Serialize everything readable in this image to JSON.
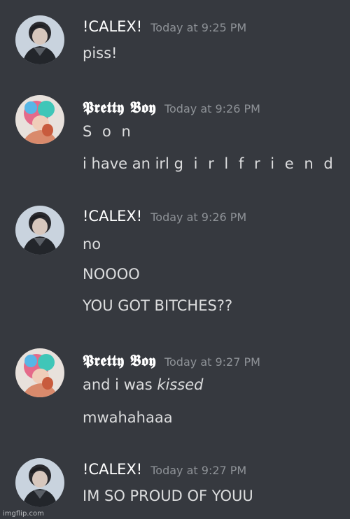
{
  "messages": [
    {
      "username": "!CALEX!",
      "timestamp": "Today at 9:25 PM",
      "lines": [
        "piss!"
      ]
    },
    {
      "username": "𝕻𝖗𝖊𝖙𝖙𝖞 𝕭𝖔𝖞",
      "timestamp": "Today at 9:26 PM",
      "lines": [
        "S o n",
        "i have an irl",
        "g i r l f r i e n d"
      ]
    },
    {
      "username": "!CALEX!",
      "timestamp": "Today at 9:26 PM",
      "lines": [
        "no",
        "NOOOO",
        "YOU GOT BITCHES??"
      ]
    },
    {
      "username": "𝕻𝖗𝖊𝖙𝖙𝖞 𝕭𝖔𝖞",
      "timestamp": "Today at 9:27 PM",
      "lines": [
        "and i was",
        "kissed",
        "mwahahaaa"
      ]
    },
    {
      "username": "!CALEX!",
      "timestamp": "Today at 9:27 PM",
      "lines": [
        "IM SO PROUD OF YOUU"
      ]
    }
  ],
  "watermark": "imgflip.com",
  "colors": {
    "background": "#36393f",
    "username": "#ffffff",
    "timestamp": "#8e9297",
    "text": "#dcddde"
  }
}
